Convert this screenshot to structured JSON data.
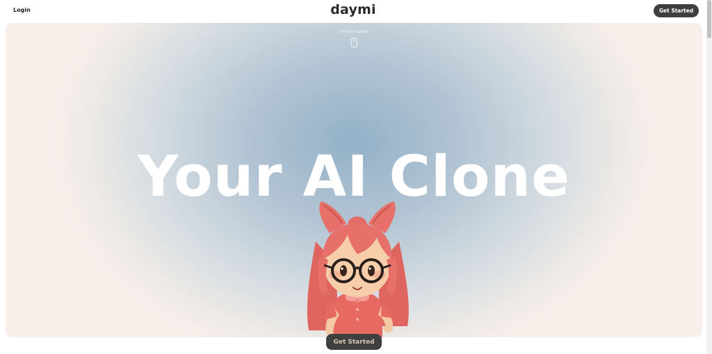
{
  "header": {
    "login_label": "Login",
    "logo_text": "daymi",
    "cta_label": "Get Started"
  },
  "hero": {
    "scroll_hint": "Scroll to explore",
    "headline": "Your AI Clone",
    "cta_label": "Get Started",
    "mouse_icon": "mouse-scroll-icon",
    "avatar": "cartoon-girl-avatar"
  },
  "colors": {
    "hero_center": "#93b1c8",
    "hero_edge": "#f8efea",
    "button_bg": "#3e3e3e",
    "button_text": "#ffffff",
    "avatar_hair": "#e8706a",
    "avatar_shirt": "#e66a62"
  }
}
